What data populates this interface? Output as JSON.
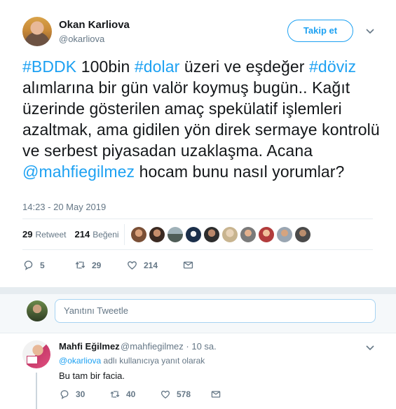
{
  "tweet": {
    "author_name": "Okan Karliova",
    "author_handle": "@okarliova",
    "follow_label": "Takip et",
    "text_parts": [
      {
        "t": "#BDDK",
        "link": true
      },
      {
        "t": " 100bin ",
        "link": false
      },
      {
        "t": "#dolar",
        "link": true
      },
      {
        "t": " üzeri ve eşdeğer ",
        "link": false
      },
      {
        "t": "#döviz",
        "link": true
      },
      {
        "t": " alımlarına bir gün valör koymuş bugün.. Kağıt üzerinde gösterilen amaç spekülatif işlemleri azaltmak, ama gidilen yön direk sermaye kontrolü ve serbest piyasadan uzaklaşma. Acana ",
        "link": false
      },
      {
        "t": "@mahfiegilmez",
        "link": true
      },
      {
        "t": " hocam bunu nasıl yorumlar?",
        "link": false
      }
    ],
    "timestamp": "14:23 - 20 May 2019",
    "retweet_count": "29",
    "retweet_label": "Retweet",
    "like_count": "214",
    "like_label": "Beğeni",
    "liker_icons": [
      "avatar-1",
      "avatar-2",
      "avatar-3",
      "avatar-4",
      "avatar-5",
      "avatar-6",
      "avatar-7",
      "avatar-8",
      "avatar-9"
    ],
    "actions": {
      "reply_count": "5",
      "retweet_count": "29",
      "like_count": "214"
    }
  },
  "reply_box": {
    "placeholder": "Yanıtını Tweetle"
  },
  "reply": {
    "author_name": "Mahfi Eğilmez",
    "author_meta": "@mahfiegilmez · 10 sa.",
    "reply_to_handle": "@okarliova",
    "reply_to_suffix": " adlı kullanıcıya yanıt olarak",
    "text": "Bu tam bir facia.",
    "actions": {
      "reply_count": "30",
      "retweet_count": "40",
      "like_count": "578"
    }
  },
  "colors": {
    "accent": "#1da1f2",
    "muted": "#657786",
    "text": "#14171a",
    "divider": "#e6ecf0"
  }
}
